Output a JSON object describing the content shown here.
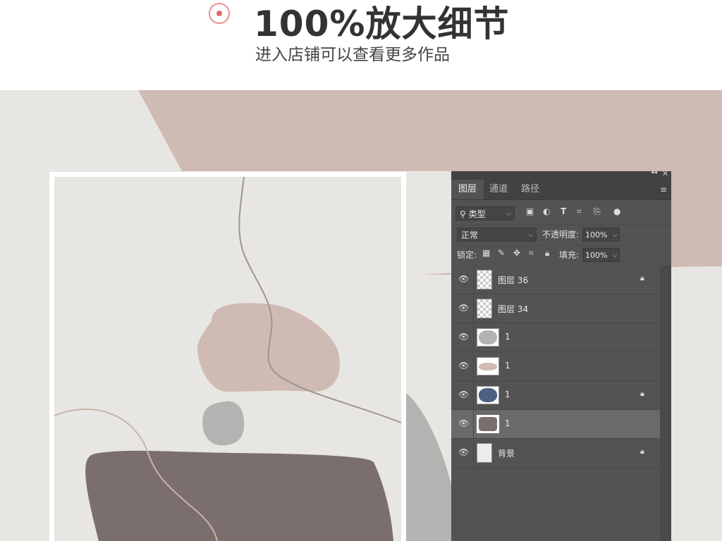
{
  "header": {
    "title": "100%放大细节",
    "subtitle": "进入店铺可以查看更多作品"
  },
  "panel": {
    "tabs": [
      {
        "label": "图层",
        "active": true
      },
      {
        "label": "通道",
        "active": false
      },
      {
        "label": "路径",
        "active": false
      }
    ],
    "filter": {
      "selected": "类型"
    },
    "blend_mode": "正常",
    "opacity_label": "不透明度:",
    "opacity_value": "100%",
    "lock_label": "锁定:",
    "fill_label": "填充:",
    "fill_value": "100%",
    "layers": [
      {
        "name": "图层 36",
        "thumb": "checker",
        "locked": true,
        "selected": false
      },
      {
        "name": "图层 34",
        "thumb": "checker",
        "locked": false,
        "selected": false
      },
      {
        "name": "1",
        "thumb": "gray-blob",
        "color": "#b3b3b1",
        "locked": false,
        "selected": false
      },
      {
        "name": "1",
        "thumb": "pink-blob",
        "color": "#cfbbb3",
        "locked": false,
        "selected": false
      },
      {
        "name": "1",
        "thumb": "blue-blob",
        "color": "#4d6183",
        "locked": true,
        "selected": false
      },
      {
        "name": "1",
        "thumb": "taupe-blob",
        "color": "#7a6f6d",
        "locked": false,
        "selected": true
      },
      {
        "name": "背景",
        "thumb": "plain",
        "locked": true,
        "selected": false
      }
    ]
  },
  "colors": {
    "background": "#e8e6e2",
    "pink_shape": "#cfbbb3",
    "gray_shape": "#b3b3b1",
    "taupe_shape": "#7b6f6e",
    "accent_bullet": "#e06a6a",
    "panel_bg": "#535353"
  }
}
